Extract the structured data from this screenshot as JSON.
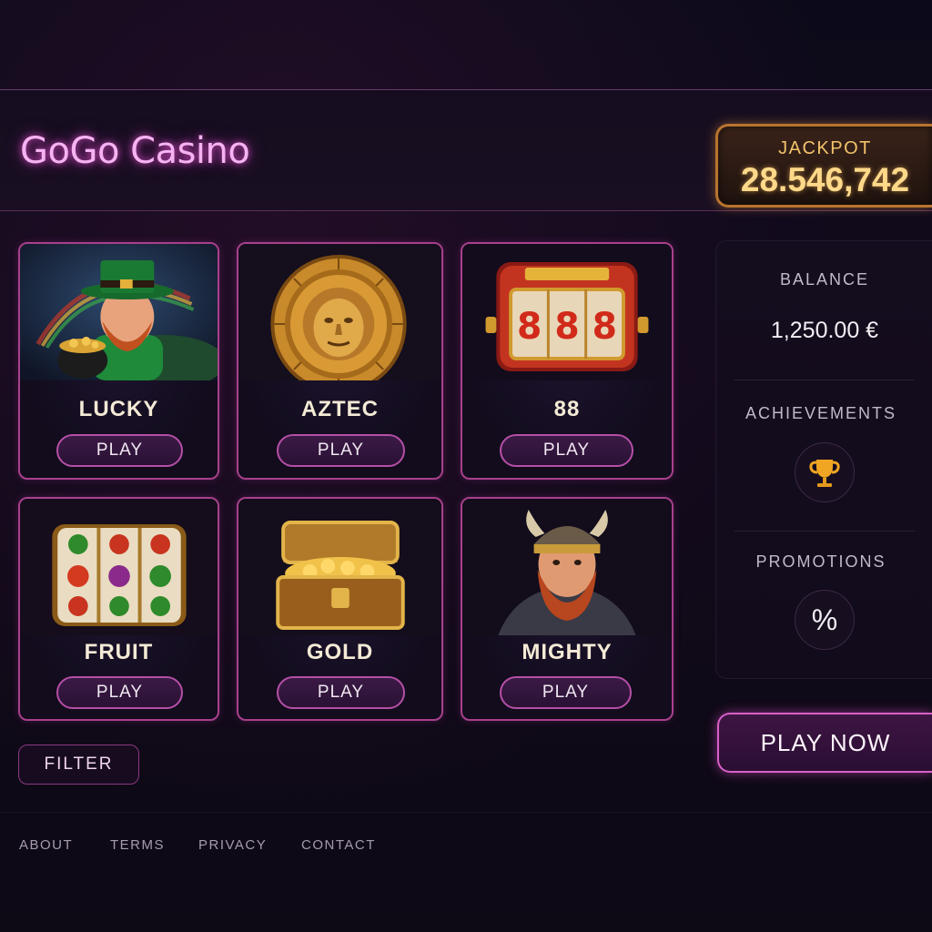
{
  "header": {
    "logo_text": "GoGo Casino",
    "jackpot_label": "JACKPOT",
    "jackpot_value": "28.546,742"
  },
  "games": [
    {
      "title": "LUCKY",
      "play_label": "PLAY",
      "art": "leprechaun-with-pot-of-gold"
    },
    {
      "title": "AZTEC",
      "play_label": "PLAY",
      "art": "aztec-golden-sun-stone"
    },
    {
      "title": "88",
      "play_label": "PLAY",
      "art": "slot-machine-888"
    },
    {
      "title": "FRUIT",
      "play_label": "PLAY",
      "art": "fruit-slot-reels"
    },
    {
      "title": "GOLD",
      "play_label": "PLAY",
      "art": "treasure-chest-gold"
    },
    {
      "title": "MIGHTY",
      "play_label": "PLAY",
      "art": "viking-warrior"
    }
  ],
  "sidebar": {
    "balance_label": "BALANCE",
    "balance_value": "1,250.00 €",
    "achievements_label": "ACHIEVEMENTS",
    "achievements_icon": "trophy-icon",
    "promotions_label": "PROMOTIONS",
    "promotions_symbol": "%",
    "promotions_icon": "percent-icon"
  },
  "actions": {
    "play_now_label": "PLAY NOW",
    "filter_label": "FILTER"
  },
  "footer": {
    "links": [
      "ABOUT",
      "TERMS",
      "PRIVACY",
      "CONTACT"
    ]
  },
  "colors": {
    "background": "#0c0a1a",
    "accent_pink": "#d860c8",
    "gold": "#f2c36a",
    "card_border": "#a8408c"
  }
}
